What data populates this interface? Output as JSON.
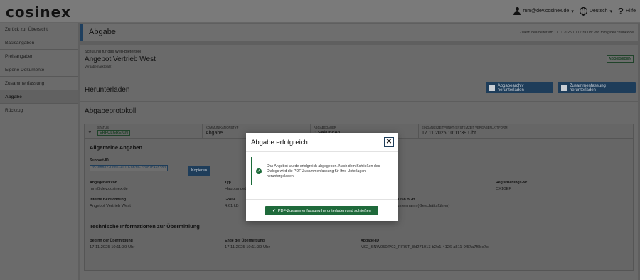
{
  "header": {
    "logo": "cosinex",
    "user_email": "mm@dev.cosinex.de",
    "language": "Deutsch",
    "help": "Hilfe"
  },
  "sidebar": {
    "items": [
      {
        "label": "Zurück zur Übersicht"
      },
      {
        "label": "Basisangaben"
      },
      {
        "label": "Preisangaben"
      },
      {
        "label": "Eigene Dokumente"
      },
      {
        "label": "Zusammenfassung"
      },
      {
        "label": "Abgabe"
      },
      {
        "label": "Rückzug"
      }
    ]
  },
  "page": {
    "title": "Abgabe",
    "last_edited": "Zuletzt bearbeitet am 17.11.2025 10:11:39 Uhr von mm@dev.cosinex.de"
  },
  "offer": {
    "course": "Schulung für das Web-Bietertool",
    "name": "Angebot Vertrieb West",
    "place": "Vergabemarktplatz",
    "status_badge": "ABGEGEBEN"
  },
  "download": {
    "title": "Herunterladen",
    "archive_button": "Abgabearchiv herunterladen",
    "summary_button": "Zusammenfassung herunterladen"
  },
  "protocol": {
    "title": "Abgabeprotokoll",
    "status_label": "STATUS",
    "status_value": "ERFOLGREICH",
    "komm_label": "KOMMUNIKATIONSTYP",
    "komm_value": "Abgabe",
    "dauer_label": "ABGABEDAUER",
    "dauer_value": "0 Sekunden",
    "eing_label": "EINGANGSZEITPUNKT (SYSTEMZEIT VERGABEPLATTFORM)",
    "eing_value": "17.11.2025 10:11:39 Uhr",
    "general_title": "Allgemeine Angaben",
    "support_label": "Support-ID",
    "support_value": "0530B882-C006-4C1D-8B3D-7F8F7E458380",
    "copy_button": "Kopieren",
    "submitted_by_label": "Abgegeben von",
    "submitted_by_value": "mm@dev.cosinex.de",
    "type_label": "Typ",
    "type_value": "Hauptangebot",
    "reg_label": "Registrierungs-Nr.",
    "reg_value": "CX10EF",
    "internal_label": "Interne Bezeichnung",
    "internal_value": "Angebot Vertrieb West",
    "size_label": "Größe",
    "size_value": "4.61 kB",
    "bgb_label": "nach § 126b BGB",
    "bgb_value": "Max Mustermann (Geschäftsführer)",
    "tech_title": "Technische Informationen zur Übermittlung",
    "begin_label": "Beginn der Übermittlung",
    "begin_value": "17.11.2025 10:11:39 Uhr",
    "end_label": "Ende der Übermittlung",
    "end_value": "17.11.2025 10:11:39 Uhr",
    "abgabe_id_label": "Abgabe-ID",
    "abgabe_id_value": "M02_SNW050/P02_FIRST_8d271013-b2b1-4126-a511-9f57a7f6be7c"
  },
  "modal": {
    "title": "Abgabe erfolgreich",
    "close": "✕",
    "message": "Das Angebot wurde erfolgreich abgegeben. Nach dem Schließen des Dialogs wird die PDF-Zusammenfassung für Ihre Unterlagen heruntergeladen.",
    "button": "PDF-Zusammenfassung herunterladen und schließen"
  }
}
